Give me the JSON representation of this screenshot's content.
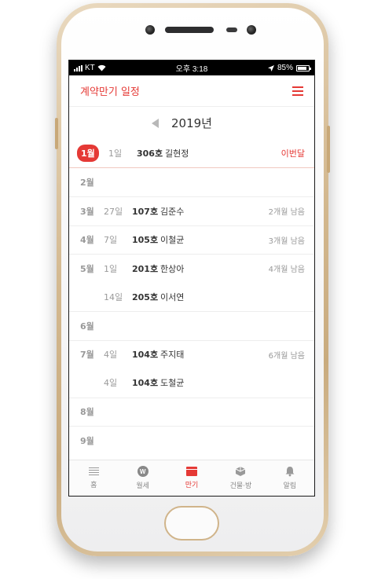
{
  "status_bar": {
    "carrier": "KT",
    "time": "오후 3:18",
    "battery": "85%"
  },
  "header": {
    "title": "계약만기 일정",
    "menu_icon": "hamburger-menu-icon"
  },
  "year_nav": {
    "year": "2019년",
    "prev_icon": "left-triangle-icon"
  },
  "schedule": [
    {
      "month": "1월",
      "entries": [
        {
          "day": "1일",
          "room": "306호",
          "tenant": "길현정",
          "note": "이번달"
        }
      ],
      "current": true
    },
    {
      "month": "2월",
      "entries": []
    },
    {
      "month": "3월",
      "entries": [
        {
          "day": "27일",
          "room": "107호",
          "tenant": "김준수",
          "note": "2개월 남음"
        }
      ]
    },
    {
      "month": "4월",
      "entries": [
        {
          "day": "7일",
          "room": "105호",
          "tenant": "이철균",
          "note": "3개월 남음"
        }
      ]
    },
    {
      "month": "5월",
      "entries": [
        {
          "day": "1일",
          "room": "201호",
          "tenant": "한상아",
          "note": "4개월 남음"
        },
        {
          "day": "14일",
          "room": "205호",
          "tenant": "이서연",
          "note": ""
        }
      ]
    },
    {
      "month": "6월",
      "entries": []
    },
    {
      "month": "7월",
      "entries": [
        {
          "day": "4일",
          "room": "104호",
          "tenant": "주지태",
          "note": "6개월 남음"
        },
        {
          "day": "4일",
          "room": "104호",
          "tenant": "도철균",
          "note": ""
        }
      ]
    },
    {
      "month": "8월",
      "entries": []
    },
    {
      "month": "9월",
      "entries": []
    }
  ],
  "tabs": [
    {
      "label": "홈",
      "icon": "list-icon",
      "active": false
    },
    {
      "label": "월세",
      "icon": "won-coin-icon",
      "active": false
    },
    {
      "label": "만기",
      "icon": "calendar-icon",
      "active": true
    },
    {
      "label": "건물·방",
      "icon": "building-icon",
      "active": false
    },
    {
      "label": "알림",
      "icon": "bell-icon",
      "active": false
    }
  ],
  "colors": {
    "accent": "#e53935",
    "muted": "#999999",
    "text": "#333333"
  }
}
